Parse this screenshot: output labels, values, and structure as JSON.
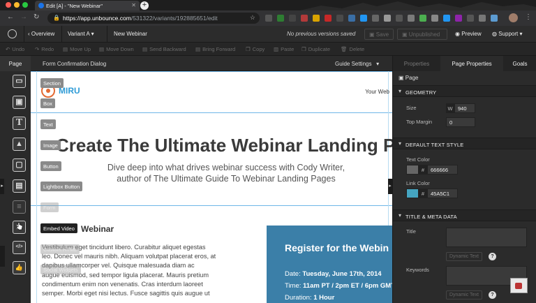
{
  "browser": {
    "tab_title": "Edit [A] - \"New Webinar\"",
    "url_domain": "https://app.unbounce.com",
    "url_path": "/531322/variants/192885651/edit"
  },
  "app_header": {
    "overview": "Overview",
    "variant": "Variant A",
    "page_name": "New Webinar",
    "status": "No previous versions saved",
    "save": "Save",
    "unpublished": "Unpublished",
    "preview": "Preview",
    "support": "Support"
  },
  "toolbar": {
    "undo": "Undo",
    "redo": "Redo",
    "move_up": "Move Up",
    "move_down": "Move Down",
    "send_backward": "Send Backward",
    "bring_forward": "Bring Forward",
    "copy": "Copy",
    "paste": "Paste",
    "duplicate": "Duplicate",
    "delete": "Delete"
  },
  "left_panel": {
    "page_tab": "Page",
    "form_dialog": "Form Confirmation Dialog",
    "guide_settings": "Guide Settings"
  },
  "widgets": [
    {
      "label": "Section",
      "glyph": "▭"
    },
    {
      "label": "Box",
      "glyph": "▣"
    },
    {
      "label": "Text",
      "glyph": "T"
    },
    {
      "label": "Image",
      "glyph": "▲"
    },
    {
      "label": "Button",
      "glyph": "▢"
    },
    {
      "label": "Lightbox Button",
      "glyph": "▤"
    },
    {
      "label": "Form",
      "glyph": "≡"
    },
    {
      "label": "Embed Video",
      "glyph": "▶"
    },
    {
      "label": "Custom HTML",
      "glyph": "</>"
    },
    {
      "label": "Social Widgets",
      "glyph": "👍"
    }
  ],
  "canvas": {
    "logo_text": "MIRU",
    "nav_text": "Your Web",
    "headline": "Create The Ultimate Webinar Landing P",
    "subheadline_1": "Dive deep into what drives webinar success with Cody Writer,",
    "subheadline_2": "author of The Ultimate Guide To Webinar Landing Pages",
    "section_heading": "Webinar",
    "body_lines": [
      "Vestibulum eget tincidunt libero. Curabitur aliquet egestas",
      "leo. Donec vel mauris nibh. Aliquam volutpat placerat eros, at",
      "dapibus ullamcorper vel. Quisque malesuada diam ac",
      "augue euismod, sed tempor ligula placerat. Mauris pretium",
      "condimentum enim non venenatis. Cras interdum laoreet",
      "semper. Morbi eget nisi lectus. Fusce sagittis quis augue ut"
    ],
    "register_title": "Register for the Webin",
    "date_label": "Date:",
    "date_value": "Tuesday, June 17th, 2014",
    "time_label": "Time:",
    "time_value": "11am PT / 2pm ET / 6pm GMT",
    "duration_label": "Duration:",
    "duration_value": "1 Hour",
    "register_color": "#3b7fa8",
    "logo_color": "#2e9bd6"
  },
  "right_panel": {
    "tabs": [
      "Properties",
      "Page Properties",
      "Goals"
    ],
    "page_label": "Page",
    "geometry": "GEOMETRY",
    "size_label": "Size",
    "size_unit": "W",
    "size_value": "940",
    "top_margin_label": "Top Margin",
    "top_margin_value": "0",
    "default_text_style": "DEFAULT TEXT STYLE",
    "text_color_label": "Text Color",
    "text_color_value": "666666",
    "text_color_hex": "#666666",
    "link_color_label": "Link Color",
    "link_color_value": "45A5C1",
    "link_color_hex": "#45A5C1",
    "hash": "#",
    "title_meta": "TITLE & META DATA",
    "title_label": "Title",
    "keywords_label": "Keywords",
    "dynamic_text": "Dynamic Text",
    "help": "?"
  }
}
